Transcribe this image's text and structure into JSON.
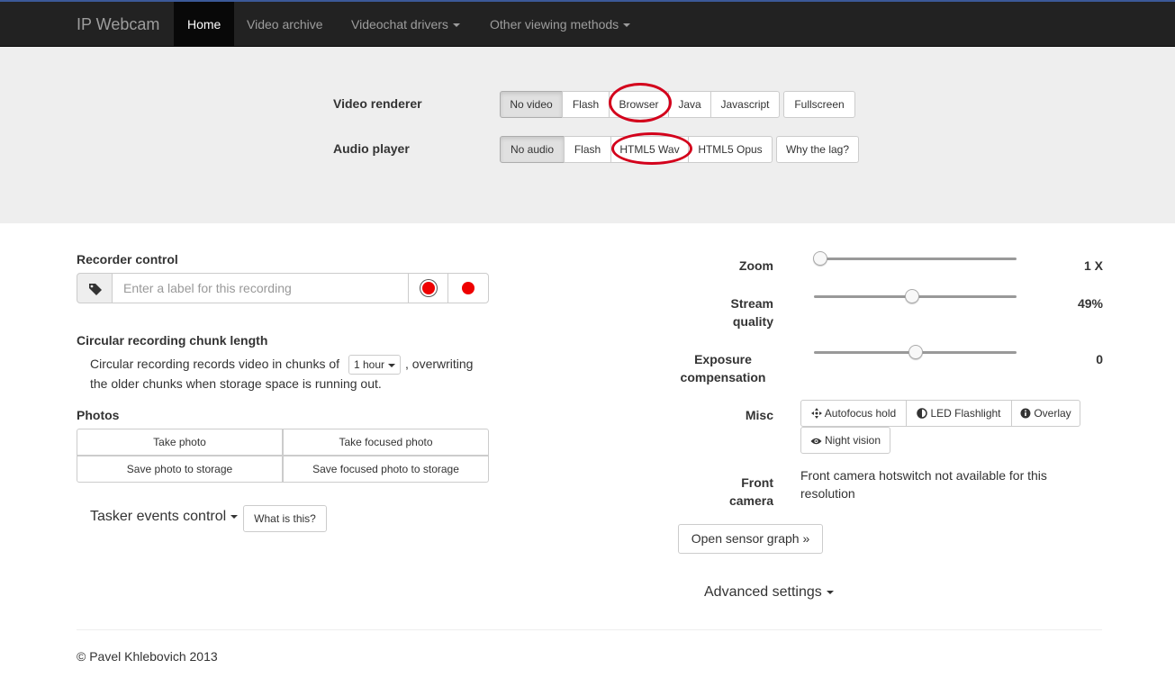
{
  "nav": {
    "brand": "IP Webcam",
    "items": [
      {
        "label": "Home",
        "active": true
      },
      {
        "label": "Video archive"
      },
      {
        "label": "Videochat drivers"
      },
      {
        "label": "Other viewing methods"
      }
    ]
  },
  "renderer": {
    "label": "Video renderer",
    "options": [
      "No video",
      "Flash",
      "Browser",
      "Java",
      "Javascript"
    ],
    "selected": "No video",
    "fullscreen": "Fullscreen"
  },
  "audio": {
    "label": "Audio player",
    "options": [
      "No audio",
      "Flash",
      "HTML5 Wav",
      "HTML5 Opus"
    ],
    "selected": "No audio",
    "lag": "Why the lag?"
  },
  "recorder": {
    "title": "Recorder control",
    "placeholder": "Enter a label for this recording"
  },
  "chunk": {
    "title": "Circular recording chunk length",
    "text_before": "Circular recording records video in chunks of",
    "select_value": "1 hour",
    "text_after": ", overwriting",
    "text_line2": "the older chunks when storage space is running out."
  },
  "photos": {
    "title": "Photos",
    "take": "Take photo",
    "take_focused": "Take focused photo",
    "save": "Save photo to storage",
    "save_focused": "Save focused photo to storage"
  },
  "tasker": {
    "label": "Tasker events control",
    "help": "What is this?"
  },
  "controls": {
    "zoom_label": "Zoom",
    "zoom_value": "1 X",
    "quality_label_1": "Stream",
    "quality_label_2": "quality",
    "quality_value": "49%",
    "quality_level": 0.49,
    "exposure_label_1": "Exposure",
    "exposure_label_2": "compensation",
    "exposure_value": "0",
    "misc_label": "Misc",
    "autofocus": "Autofocus hold",
    "led": "LED Flashlight",
    "overlay": "Overlay",
    "night": "Night vision",
    "front_label_1": "Front",
    "front_label_2": "camera",
    "front_text_1": "Front camera hotswitch not available for this",
    "front_text_2": "resolution",
    "sensor": "Open sensor graph »",
    "advanced": "Advanced settings"
  },
  "footer": "© Pavel Khlebovich 2013",
  "colors": {
    "highlight": "#d3001b",
    "record": "#e00000",
    "navbar": "#222222"
  }
}
